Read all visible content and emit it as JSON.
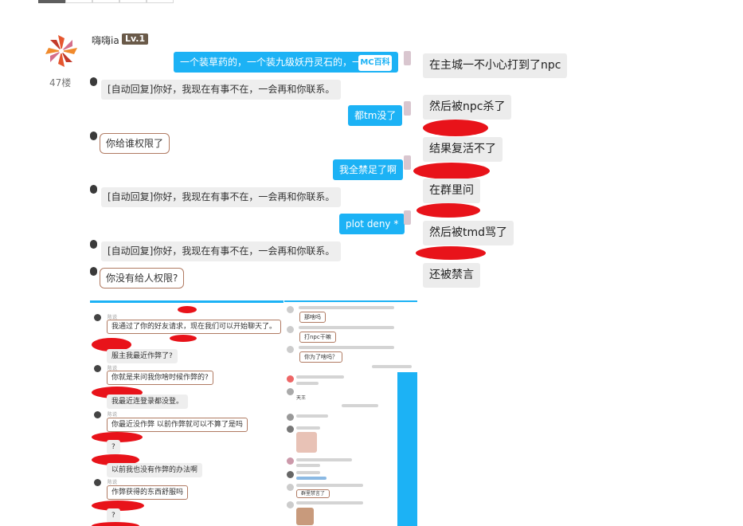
{
  "tabs": [
    "",
    "",
    "",
    "",
    ""
  ],
  "post": {
    "username": "嗨嗨ia",
    "level": "Lv.1",
    "floor": "47楼"
  },
  "chat": {
    "top_out": "一个装草药的，一个装九级妖丹灵石的，一个",
    "logo": "MC百科",
    "auto_reply": "[自动回复]你好，我现在有事不在，一会再和你联系。",
    "msg_dutm": "都tm没了",
    "msg_quanxian": "你给谁权限了",
    "msg_jinzu": "我全禁足了啊",
    "msg_plot": "plot deny *",
    "msg_meigei": "你没有给人权限?"
  },
  "notes": [
    "在主城一不小心打到了npc",
    "然后被npc杀了",
    "结果复活不了",
    "在群里问",
    "然后被tmd骂了",
    "还被禁言"
  ],
  "shot_left": {
    "sender": "陈说",
    "m1": "我通过了你的好友请求，现在我们可以开始聊天了。",
    "m2": "服主我最近作弊了?",
    "m3": "你就是来问我你啥时候作弊的?",
    "m4": "我最近连登录都没登。",
    "m5": "你最近没作弊 以前作弊就可以不算了是吗",
    "m6": "?",
    "m7": "以前我也没有作弊的办法啊",
    "m8": "作弊获得的东西舒服吗",
    "m9": "?"
  },
  "shot_right": {
    "r1": "那啥吗",
    "r2": "打npc干嘛",
    "r3": "你为了啥吗？",
    "r4": "天王",
    "r5": "群里禁言了"
  },
  "colors": {
    "chat_blue": "#1cb2f5",
    "redact_red": "#e8131a",
    "level_badge": "#6a5a49"
  }
}
